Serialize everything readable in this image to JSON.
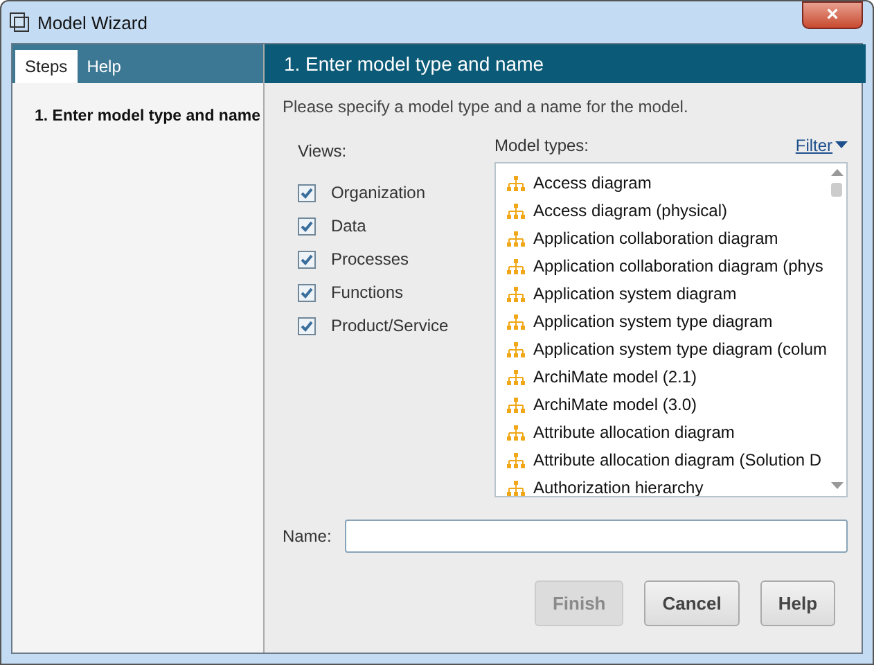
{
  "window": {
    "title": "Model Wizard",
    "close": "×"
  },
  "sidebar": {
    "tabs": [
      {
        "label": "Steps",
        "selected": true
      },
      {
        "label": "Help",
        "selected": false
      }
    ],
    "steps": [
      {
        "label": "1. Enter model type and name",
        "selected": true
      }
    ]
  },
  "header": "1. Enter model type and name",
  "instruction": "Please specify a model type and a name for the model.",
  "views": {
    "label": "Views:",
    "items": [
      {
        "label": "Organization",
        "checked": true
      },
      {
        "label": "Data",
        "checked": true
      },
      {
        "label": "Processes",
        "checked": true
      },
      {
        "label": "Functions",
        "checked": true
      },
      {
        "label": "Product/Service",
        "checked": true
      }
    ]
  },
  "model_types": {
    "label": "Model types:",
    "filter": "Filter",
    "items": [
      "Access diagram",
      "Access diagram (physical)",
      "Application collaboration diagram",
      "Application collaboration diagram (phys",
      "Application system diagram",
      "Application system type diagram",
      "Application system type diagram (colum",
      "ArchiMate model (2.1)",
      "ArchiMate model (3.0)",
      "Attribute allocation diagram",
      "Attribute allocation diagram (Solution D",
      "Authorization hierarchy"
    ]
  },
  "name_field": {
    "label": "Name:"
  },
  "buttons": [
    {
      "label": "Finish",
      "disabled": true
    },
    {
      "label": "Cancel",
      "disabled": false
    },
    {
      "label": "Help",
      "disabled": false
    }
  ]
}
